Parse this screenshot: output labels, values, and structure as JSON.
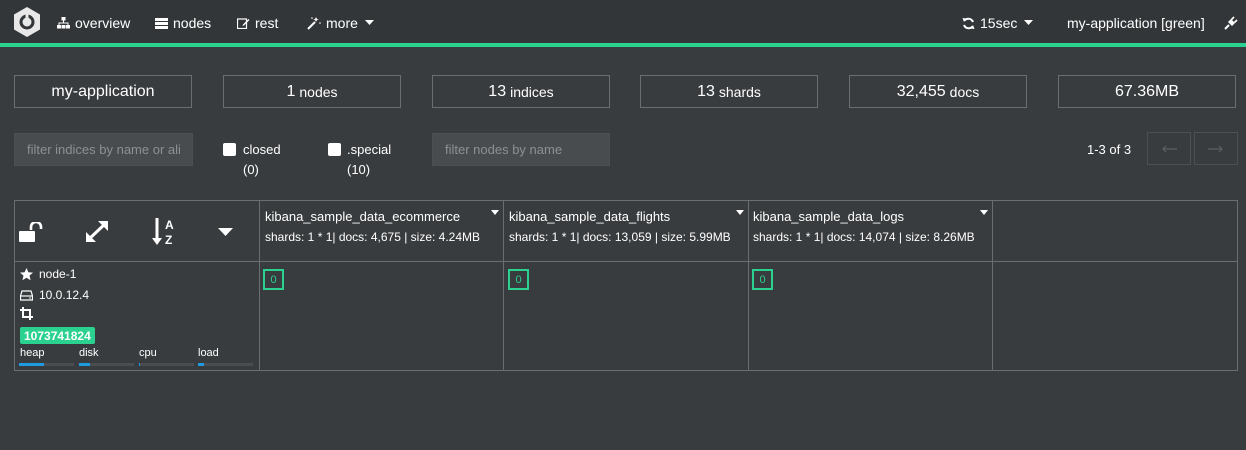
{
  "navbar": {
    "items": [
      {
        "label": "overview",
        "icon": "sitemap-icon"
      },
      {
        "label": "nodes",
        "icon": "server-icon"
      },
      {
        "label": "rest",
        "icon": "edit-icon"
      },
      {
        "label": "more",
        "icon": "magic-wand-icon"
      }
    ],
    "refresh_interval": "15sec",
    "cluster_status": "my-application [green]",
    "accent_color": "#2bd28f"
  },
  "stats": {
    "cluster_name": "my-application",
    "nodes_value": "1",
    "nodes_label": "nodes",
    "indices_value": "13",
    "indices_label": "indices",
    "shards_value": "13",
    "shards_label": "shards",
    "docs_value": "32,455",
    "docs_label": "docs",
    "size": "67.36MB"
  },
  "filters": {
    "indices_placeholder": "filter indices by name or aliases",
    "closed_label": "closed",
    "closed_count": "(0)",
    "special_label": ".special",
    "special_count": "(10)",
    "nodes_placeholder": "filter nodes by name"
  },
  "paging": {
    "text": "1-3 of 3",
    "prev_icon": "arrow-left-icon",
    "next_icon": "arrow-right-icon"
  },
  "indices": [
    {
      "name": "kibana_sample_data_ecommerce",
      "info": "shards: 1 * 1| docs: 4,675 | size: 4.24MB",
      "shard": "0"
    },
    {
      "name": "kibana_sample_data_flights",
      "info": "shards: 1 * 1| docs: 13,059 | size: 5.99MB",
      "shard": "0"
    },
    {
      "name": "kibana_sample_data_logs",
      "info": "shards: 1 * 1| docs: 14,074 | size: 8.26MB",
      "shard": "0"
    }
  ],
  "node": {
    "name": "node-1",
    "ip": "10.0.12.4",
    "id": "1073741824",
    "metrics": [
      {
        "label": "heap",
        "value": 0.45
      },
      {
        "label": "disk",
        "value": 0.2
      },
      {
        "label": "cpu",
        "value": 0.02
      },
      {
        "label": "load",
        "value": 0.1
      }
    ]
  }
}
